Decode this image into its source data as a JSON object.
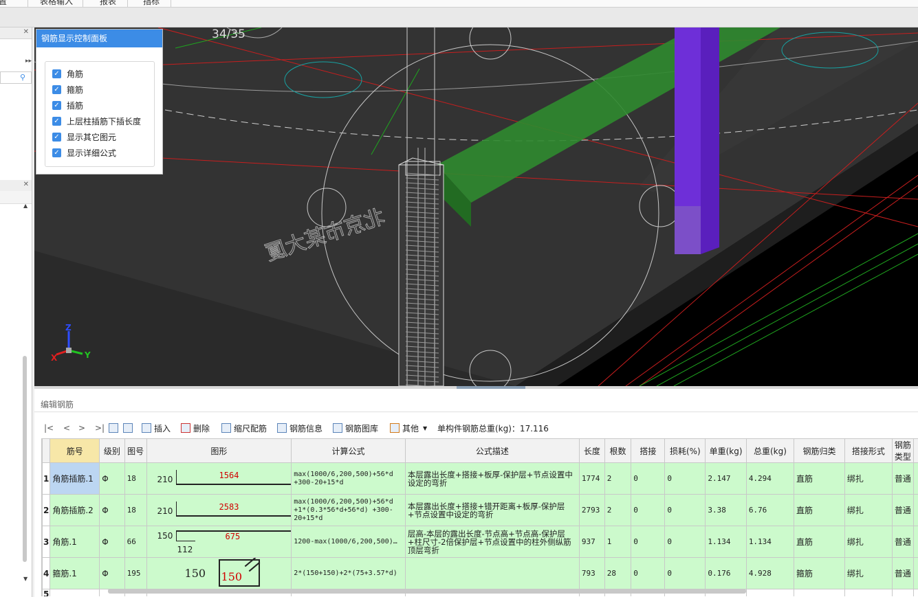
{
  "menu": {
    "items": [
      "置",
      "表格输入",
      "报表",
      "指标"
    ]
  },
  "viewport": {
    "page_counter": "34/35",
    "axis": {
      "x": "X",
      "y": "Y",
      "z": "Z"
    }
  },
  "control_panel": {
    "title": "钢筋显示控制面板",
    "options": [
      {
        "label": "角筋",
        "checked": true
      },
      {
        "label": "箍筋",
        "checked": true
      },
      {
        "label": "插筋",
        "checked": true
      },
      {
        "label": "上层柱插筋下插长度",
        "checked": true
      },
      {
        "label": "显示其它图元",
        "checked": true
      },
      {
        "label": "显示详细公式",
        "checked": true
      }
    ]
  },
  "edit_panel": {
    "title": "编辑钢筋",
    "nav": [
      "|<",
      "<",
      ">",
      ">|"
    ],
    "toolbar": {
      "insert": "插入",
      "delete": "删除",
      "scale_rebar": "缩尺配筋",
      "rebar_info": "钢筋信息",
      "rebar_library": "钢筋图库",
      "other": "其他",
      "total_weight": "单构件钢筋总重(kg)：17.116"
    },
    "columns": [
      "筋号",
      "级别",
      "图号",
      "图形",
      "计算公式",
      "公式描述",
      "长度",
      "根数",
      "搭接",
      "损耗(%)",
      "单重(kg)",
      "总重(kg)",
      "钢筋归类",
      "搭接形式",
      "钢筋类型"
    ],
    "rows": [
      {
        "num": "1",
        "name": "角筋插筋.1",
        "grade": "Φ",
        "fig": "18",
        "shape_left": "210",
        "shape_val": "1564",
        "shape_extra": "",
        "formula": "max(1000/6,200,500)+56*d +300-20+15*d",
        "desc": "本层露出长度+搭接+板厚-保护层+节点设置中设定的弯折",
        "length": "1774",
        "count": "2",
        "lap": "0",
        "loss": "0",
        "unit_w": "2.147",
        "total_w": "4.294",
        "category": "直筋",
        "lap_form": "绑扎",
        "type": "普通"
      },
      {
        "num": "2",
        "name": "角筋插筋.2",
        "grade": "Φ",
        "fig": "18",
        "shape_left": "210",
        "shape_val": "2583",
        "shape_extra": "",
        "formula": "max(1000/6,200,500)+56*d +1*(0.3*56*d+56*d) +300-20+15*d",
        "desc": "本层露出长度+搭接+错开距离+板厚-保护层+节点设置中设定的弯折",
        "length": "2793",
        "count": "2",
        "lap": "0",
        "loss": "0",
        "unit_w": "3.38",
        "total_w": "6.76",
        "category": "直筋",
        "lap_form": "绑扎",
        "type": "普通"
      },
      {
        "num": "3",
        "name": "角筋.1",
        "grade": "Φ",
        "fig": "66",
        "shape_left": "150",
        "shape_val": "675",
        "shape_extra": "112",
        "formula": "1200-max(1000/6,200,500)…",
        "desc": "层高-本层的露出长度-节点高+节点高-保护层+柱尺寸-2倍保护层+节点设置中的柱外侧纵筋顶层弯折",
        "length": "937",
        "count": "1",
        "lap": "0",
        "loss": "0",
        "unit_w": "1.134",
        "total_w": "1.134",
        "category": "直筋",
        "lap_form": "绑扎",
        "type": "普通"
      },
      {
        "num": "4",
        "name": "箍筋.1",
        "grade": "Φ",
        "fig": "195",
        "shape_left": "150",
        "shape_val": "150",
        "shape_extra": "",
        "formula": "2*(150+150)+2*(75+3.57*d)",
        "desc": "",
        "length": "793",
        "count": "28",
        "lap": "0",
        "loss": "0",
        "unit_w": "0.176",
        "total_w": "4.928",
        "category": "箍筋",
        "lap_form": "绑扎",
        "type": "普通"
      }
    ],
    "empty_row_num": "5"
  }
}
